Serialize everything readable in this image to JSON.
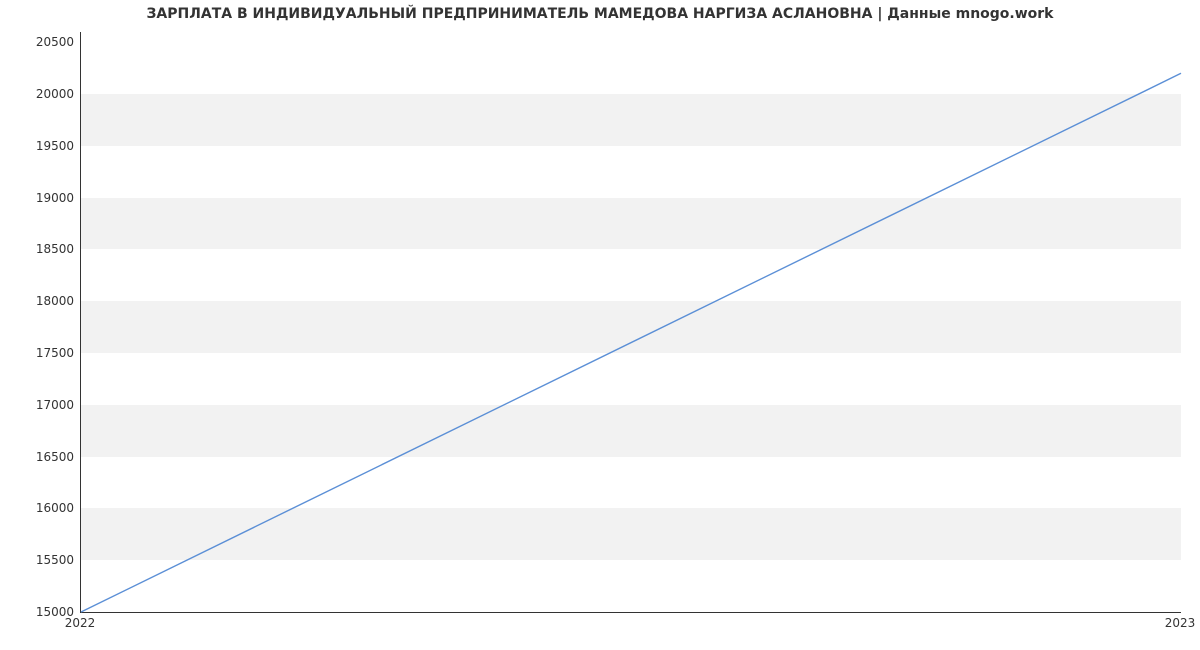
{
  "chart_data": {
    "type": "line",
    "title": "ЗАРПЛАТА В ИНДИВИДУАЛЬНЫЙ ПРЕДПРИНИМАТЕЛЬ МАМЕДОВА НАРГИЗА АСЛАНОВНА | Данные mnogo.work",
    "xlabel": "",
    "ylabel": "",
    "x_ticks": [
      "2022",
      "2023"
    ],
    "y_ticks": [
      15000,
      15500,
      16000,
      16500,
      17000,
      17500,
      18000,
      18500,
      19000,
      19500,
      20000,
      20500
    ],
    "ylim": [
      15000,
      20600
    ],
    "series": [
      {
        "name": "salary",
        "color": "#5b8fd6",
        "x": [
          "2022",
          "2023"
        ],
        "values": [
          15000,
          20200
        ]
      }
    ]
  }
}
